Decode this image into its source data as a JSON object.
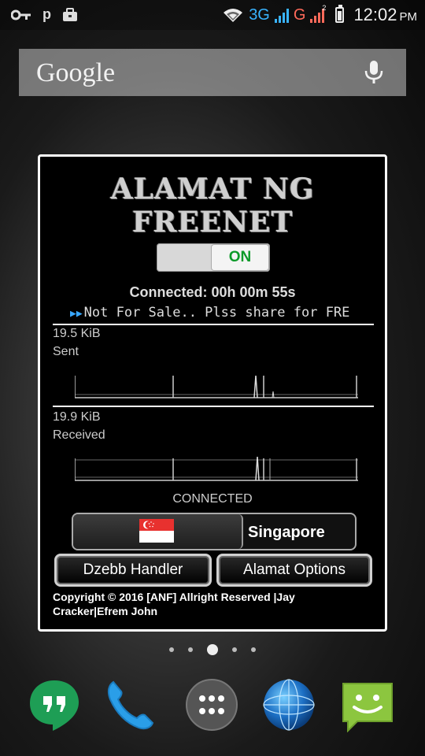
{
  "status_bar": {
    "network_3g": "3G",
    "network_g": "G",
    "sim2_badge": "2",
    "time": "12:02",
    "ampm": "PM",
    "icons": [
      "key-icon",
      "p-icon",
      "briefcase-icon",
      "wifi-icon",
      "signal-icon",
      "battery-icon"
    ]
  },
  "search": {
    "logo": "Google",
    "mic": "mic-icon"
  },
  "widget": {
    "title": "ALAMAT NG FREENET",
    "toggle_label": "ON",
    "connection_time": "Connected: 00h 00m 55s",
    "marquee": "Not For Sale.. Plss share for FRE",
    "sent": {
      "value": "19.5 KiB",
      "label": "Sent"
    },
    "received": {
      "value": "19.9 KiB",
      "label": "Received"
    },
    "status": "CONNECTED",
    "server": {
      "name": "Singapore",
      "flag": "singapore-flag"
    },
    "buttons": {
      "handler": "Dzebb Handler",
      "options": "Alamat Options"
    },
    "copyright": "Copyright © 2016 [ANF] Allright Reserved |Jay Cracker|Efrem John"
  },
  "home": {
    "page_count": 5,
    "active_page": 3,
    "dock": [
      "hangouts-icon",
      "phone-icon",
      "app-drawer-icon",
      "browser-globe-icon",
      "messaging-icon"
    ]
  },
  "colors": {
    "toggle_on": "#0d9a2a",
    "network_blue": "#39b4ff",
    "network_red": "#ff6a5a",
    "widget_bg": "#000000"
  }
}
